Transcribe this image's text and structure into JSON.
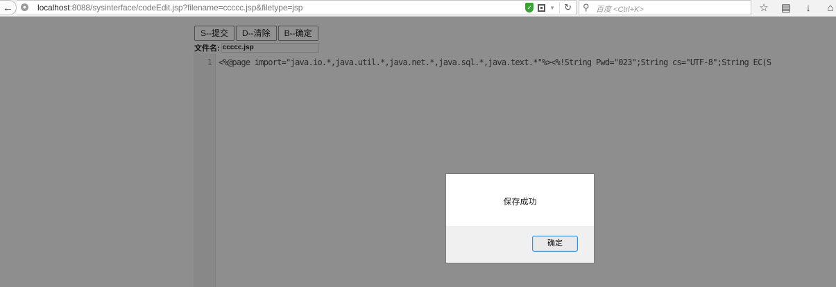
{
  "browser": {
    "url_host": "localhost",
    "url_rest": ":8088/sysinterface/codeEdit.jsp?filename=ccccc.jsp&filetype=jsp",
    "search_placeholder": "百度 <Ctrl+K>",
    "icons": [
      "back-icon",
      "globe-icon",
      "shield-icon",
      "qr-icon",
      "dropdown-icon",
      "reload-icon",
      "search-icon",
      "star-icon",
      "reading-list-icon",
      "download-icon",
      "home-icon"
    ]
  },
  "toolbar": {
    "submit_label": "S--提交",
    "clear_label": "D--清除",
    "confirm_label": "B--确定"
  },
  "file": {
    "label": "文件名:",
    "name": "ccccc.jsp"
  },
  "editor": {
    "line_number": "1",
    "code": "<%@page import=\"java.io.*,java.util.*,java.net.*,java.sql.*,java.text.*\"%><%!String Pwd=\"023\";String cs=\"UTF-8\";String EC(S"
  },
  "dialog": {
    "message": "保存成功",
    "ok_label": "确定"
  },
  "colors": {
    "overlay": "#8e8e8e",
    "dialog_bg": "#ffffff",
    "dialog_footer": "#f0f0f0",
    "ok_border": "#3c8ad8"
  }
}
